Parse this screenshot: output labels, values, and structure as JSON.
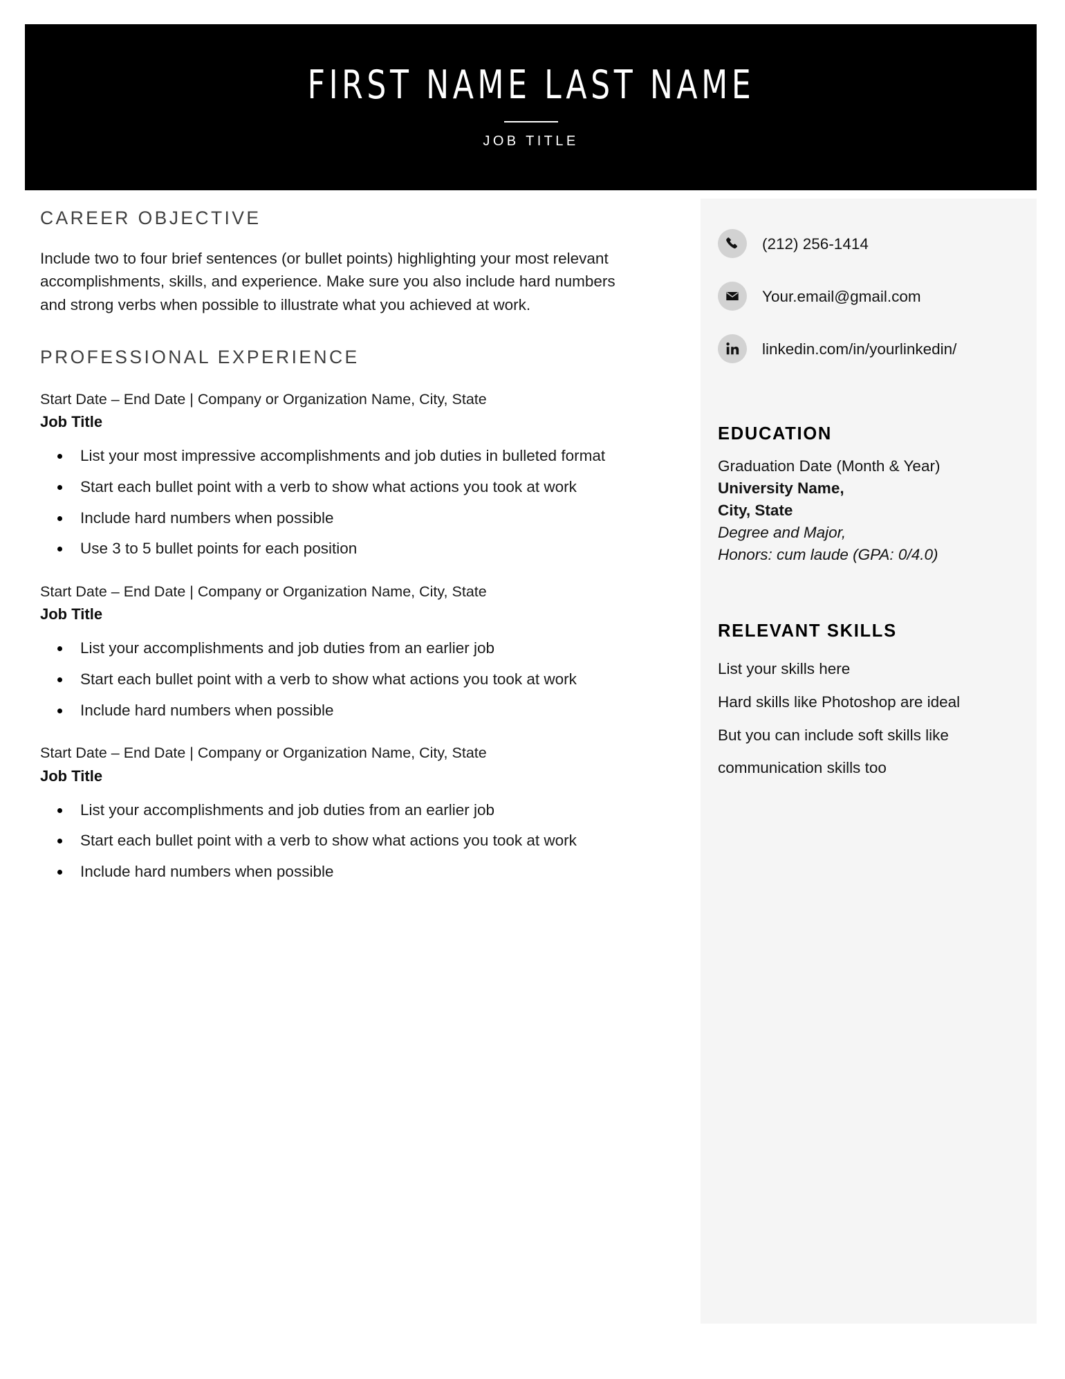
{
  "header": {
    "name": "FIRST NAME LAST NAME",
    "job_title": "JOB TITLE",
    "background_color": "#000000",
    "text_color": "#ffffff"
  },
  "main": {
    "objective": {
      "heading": "CAREER OBJECTIVE",
      "body": "Include two to four brief sentences (or bullet points) highlighting your most relevant accomplishments, skills, and experience. Make sure you also include hard numbers and strong verbs when possible to illustrate what you achieved at work."
    },
    "experience": {
      "heading": "PROFESSIONAL EXPERIENCE",
      "jobs": [
        {
          "meta": "Start Date – End Date | Company or Organization Name, City, State",
          "title": "Job Title",
          "bullets": [
            "List your most impressive accomplishments and job duties in bulleted format",
            "Start each bullet point with a verb to show what actions you took at work",
            "Include hard numbers when possible",
            "Use 3 to 5 bullet points for each position"
          ]
        },
        {
          "meta": "Start Date – End Date | Company or Organization Name, City, State",
          "title": "Job Title",
          "bullets": [
            "List your accomplishments and job duties from an earlier job",
            "Start each bullet point with a verb to show what actions you took at work",
            "Include hard numbers when possible"
          ]
        },
        {
          "meta": "Start Date – End Date | Company or Organization Name, City, State",
          "title": "Job Title",
          "bullets": [
            "List your accomplishments and job duties from an earlier job",
            "Start each bullet point with a verb to show what actions you took at work",
            "Include hard numbers when possible"
          ]
        }
      ]
    }
  },
  "sidebar": {
    "background_color": "#f5f5f5",
    "contact": [
      {
        "icon": "phone-icon",
        "value": "(212) 256-1414"
      },
      {
        "icon": "email-icon",
        "value": "Your.email@gmail.com"
      },
      {
        "icon": "linkedin-icon",
        "value": "linkedin.com/in/yourlinkedin/"
      }
    ],
    "education": {
      "heading": "EDUCATION",
      "lines": [
        "Graduation Date (Month & Year)",
        "University Name,",
        "City, State",
        "Degree and Major,",
        "Honors: cum laude (GPA: 0/4.0)"
      ]
    },
    "skills": {
      "heading": "RELEVANT SKILLS",
      "items": [
        "List your skills here",
        "Hard skills like Photoshop are ideal",
        "But you can include soft skills like communication skills too"
      ]
    }
  }
}
